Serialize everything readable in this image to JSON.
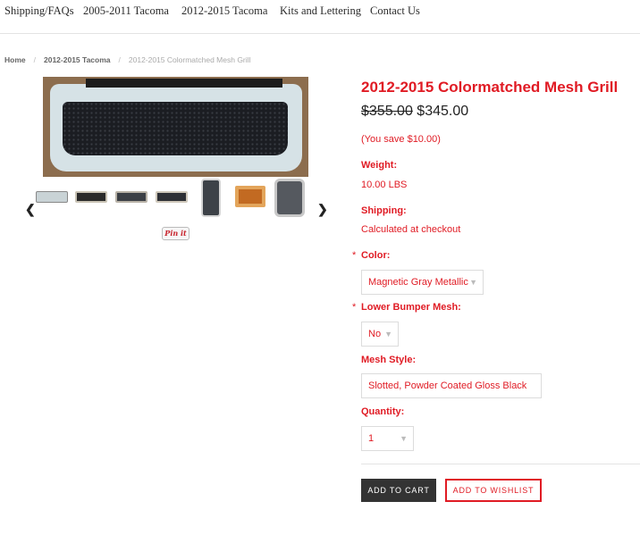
{
  "nav": {
    "items": [
      {
        "label": "Shipping/FAQs"
      },
      {
        "label": "2005-2011 Tacoma"
      },
      {
        "label": "2012-2015 Tacoma"
      },
      {
        "label": "Kits and Lettering"
      },
      {
        "label": "Contact Us"
      }
    ]
  },
  "breadcrumb": {
    "home": "Home",
    "category": "2012-2015 Tacoma",
    "current": "2012-2015 Colormatched Mesh Grill",
    "separator": "/"
  },
  "gallery": {
    "prev_icon": "chevron-left-icon",
    "next_icon": "chevron-right-icon",
    "prev_glyph": "❮",
    "next_glyph": "❯",
    "pin_label": "Pin it"
  },
  "product": {
    "title": "2012-2015 Colormatched Mesh Grill",
    "price_old": "$355.00",
    "price_new": "$345.00",
    "you_save": "(You save $10.00)",
    "weight_label": "Weight:",
    "weight_value": "10.00 LBS",
    "shipping_label": "Shipping:",
    "shipping_value": "Calculated at checkout",
    "required_mark": "*",
    "color_label": "Color:",
    "color_value": "Magnetic Gray Metallic",
    "bumper_label": "Lower Bumper Mesh:",
    "bumper_value": "No",
    "mesh_label": "Mesh Style:",
    "mesh_value": "Slotted, Powder Coated Gloss Black",
    "quantity_label": "Quantity:",
    "quantity_value": "1",
    "add_to_cart": "ADD TO CART",
    "add_to_wishlist": "ADD TO WISHLIST"
  },
  "colors": {
    "accent": "#e01b24",
    "button_dark": "#333333"
  }
}
